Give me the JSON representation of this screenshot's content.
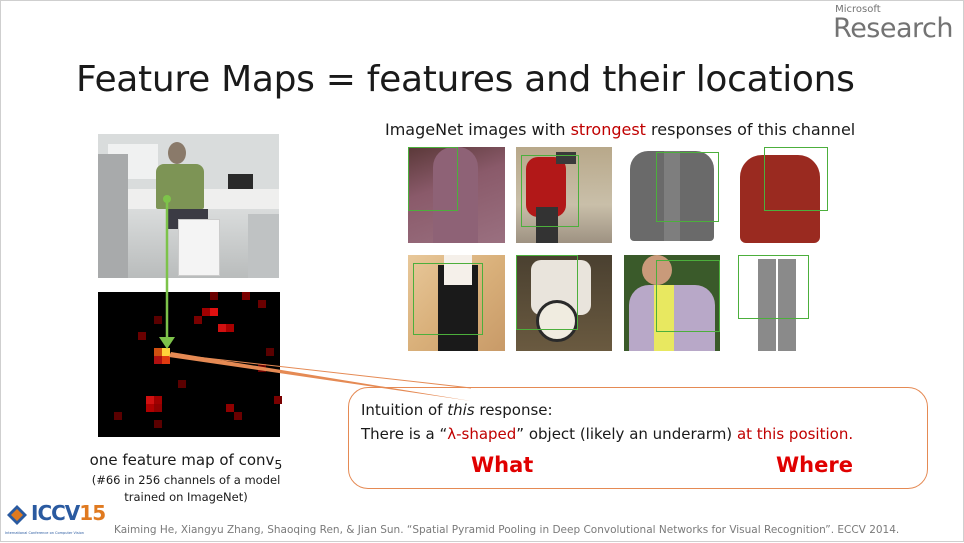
{
  "branding": {
    "microsoft": "Microsoft",
    "research": "Research"
  },
  "title": "Feature Maps = features and their locations",
  "top_caption": {
    "before": "ImageNet images with ",
    "highlight": "strongest",
    "after": " responses of this channel"
  },
  "feature_map_caption": {
    "line1": "one feature map of conv",
    "subscript": "5",
    "line2": "(#66 in 256 channels of a model",
    "line3": "trained on ImageNet)"
  },
  "callout": {
    "line1_before": "Intuition of ",
    "line1_italic": "this",
    "line1_after": " response:",
    "line2_before": "There is a “",
    "line2_red": "λ-shaped",
    "line2_mid": "” object (likely an underarm) ",
    "line2_red2": "at this position.",
    "what": "What",
    "where": "Where"
  },
  "citation": "Kaiming He, Xiangyu Zhang, Shaoqing Ren, & Jian Sun. “Spatial Pyramid Pooling in Deep Convolutional Networks for Visual Recognition”. ECCV 2014.",
  "logo": {
    "text": "ICCV",
    "num": "15",
    "sub": "International Conference on Computer Vision"
  },
  "colors": {
    "accent_red": "#c00000",
    "box_green": "#4caf3c",
    "callout_border": "#e58a54"
  }
}
